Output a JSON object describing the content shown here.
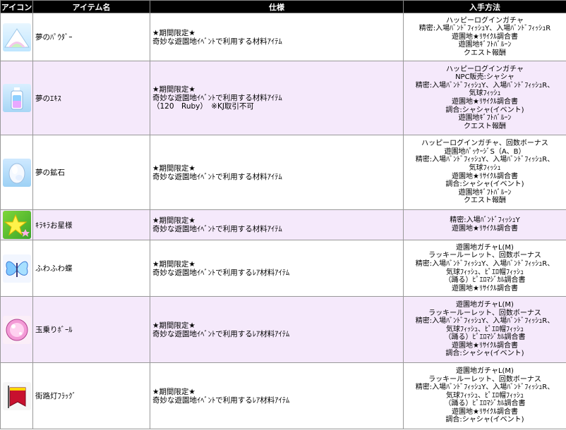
{
  "headers": {
    "icon": "アイコン",
    "name": "アイテム名",
    "spec": "仕様",
    "obtain": "入手方法"
  },
  "rows": [
    {
      "name": "夢のﾊﾟｳﾀﾞｰ",
      "icon": "dream-powder-icon",
      "spec": [
        "★期間限定★",
        "奇妙な遊園地ｲﾍﾞﾝﾄで利用する材料ｱｲﾃﾑ"
      ],
      "obtain": [
        "ハッピーログインガチャ",
        "精密:入場ﾊﾞﾝﾄﾞﾌｨｯｼｭY、入場ﾊﾞﾝﾄﾞﾌｨｯｼｭR",
        "遊園地★ﾘｻｲｸﾙ調合書",
        "遊園地ｷﾞﾌﾄﾊﾞﾙｰﾝ",
        "クエスト報酬"
      ]
    },
    {
      "name": "夢のｴｷｽ",
      "icon": "dream-extract-icon",
      "spec": [
        "★期間限定★",
        "奇妙な遊園地ｲﾍﾞﾝﾄで利用する材料ｱｲﾃﾑ",
        "（120　Ruby）　※KJ取引不可"
      ],
      "obtain": [
        "ハッピーログインガチャ",
        "NPC販売:シャシャ",
        "精密:入場ﾊﾞﾝﾄﾞﾌｨｯｼｭY、入場ﾊﾞﾝﾄﾞﾌｨｯｼｭR、",
        "気球ﾌｨｯｼｭ",
        "遊園地★ﾘｻｲｸﾙ調合書",
        "調合:シャシャ(イベント)",
        "遊園地ｷﾞﾌﾄﾊﾞﾙｰﾝ",
        "クエスト報酬"
      ]
    },
    {
      "name": "夢の鉱石",
      "icon": "dream-ore-icon",
      "spec": [
        "★期間限定★",
        "奇妙な遊園地ｲﾍﾞﾝﾄで利用する材料ｱｲﾃﾑ"
      ],
      "obtain": [
        "ハッピーログインガチャ、回数ボーナス",
        "遊園地ﾊﾟｯｹｰｼﾞS（A、B）",
        "精密:入場ﾊﾞﾝﾄﾞﾌｨｯｼｭY、入場ﾊﾞﾝﾄﾞﾌｨｯｼｭR、",
        "気球ﾌｨｯｼｭ",
        "遊園地★ﾘｻｲｸﾙ調合書",
        "調合:シャシャ(イベント)",
        "遊園地ｷﾞﾌﾄﾊﾞﾙｰﾝ",
        "クエスト報酬"
      ]
    },
    {
      "name": "ｷﾗｷﾗお星様",
      "icon": "sparkle-star-icon",
      "spec": [
        "★期間限定★",
        "奇妙な遊園地ｲﾍﾞﾝﾄで利用する材料ｱｲﾃﾑ"
      ],
      "obtain": [
        "精密:入場ﾊﾞﾝﾄﾞﾌｨｯｼｭY",
        "遊園地★ﾘｻｲｸﾙ調合書"
      ]
    },
    {
      "name": "ふわふわ蝶",
      "icon": "fluffy-butterfly-icon",
      "spec": [
        "★期間限定★",
        "奇妙な遊園地ｲﾍﾞﾝﾄで利用するﾚｱ材料ｱｲﾃﾑ"
      ],
      "obtain": [
        "遊園地ガチャL(M)",
        "ラッキールーレット、回数ボーナス",
        "精密:入場ﾊﾞﾝﾄﾞﾌｨｯｼｭY、入場ﾊﾞﾝﾄﾞﾌｨｯｼｭR、",
        "気球ﾌｨｯｼｭ、ﾋﾟｴﾛ帽ﾌｨｯｼｭ",
        "（踊る）ﾋﾟｴﾛﾏｼﾞｶﾙ調合書",
        "遊園地★ﾘｻｲｸﾙ調合書"
      ]
    },
    {
      "name": "玉乗りﾎﾞｰﾙ",
      "icon": "circus-ball-icon",
      "spec": [
        "★期間限定★",
        "奇妙な遊園地ｲﾍﾞﾝﾄで利用するﾚｱ材料ｱｲﾃﾑ"
      ],
      "obtain": [
        "遊園地ガチャL(M)",
        "ラッキールーレット、回数ボーナス",
        "精密:入場ﾊﾞﾝﾄﾞﾌｨｯｼｭY、入場ﾊﾞﾝﾄﾞﾌｨｯｼｭR、",
        "気球ﾌｨｯｼｭ、ﾋﾟｴﾛ帽ﾌｨｯｼｭ",
        "（踊る）ﾋﾟｴﾛﾏｼﾞｶﾙ調合書",
        "遊園地★ﾘｻｲｸﾙ調合書",
        "調合:シャシャ(イベント)"
      ]
    },
    {
      "name": "街路灯ﾌﾗｯｸﾞ",
      "icon": "streetlight-flag-icon",
      "spec": [
        "★期間限定★",
        "奇妙な遊園地ｲﾍﾞﾝﾄで利用するﾚｱ材料ｱｲﾃﾑ"
      ],
      "obtain": [
        "遊園地ガチャL(M)",
        "ラッキールーレット、回数ボーナス",
        "精密:入場ﾊﾞﾝﾄﾞﾌｨｯｼｭY、入場ﾊﾞﾝﾄﾞﾌｨｯｼｭR、",
        "気球ﾌｨｯｼｭ、ﾋﾟｴﾛ帽ﾌｨｯｼｭ",
        "（踊る）ﾋﾟｴﾛﾏｼﾞｶﾙ調合書",
        "遊園地★ﾘｻｲｸﾙ調合書",
        "調合:シャシャ(イベント)"
      ]
    }
  ],
  "colors": {
    "header_bg": "#000000",
    "row_odd": "#ffffff",
    "row_even": "#f5e9fb"
  }
}
